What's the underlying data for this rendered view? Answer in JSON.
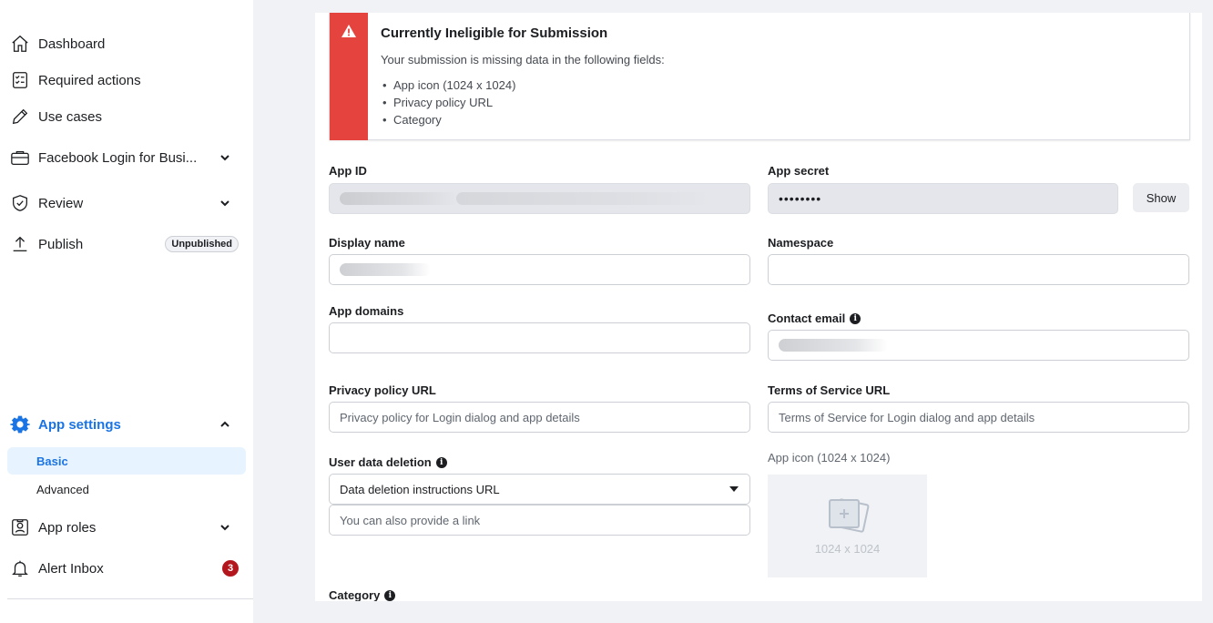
{
  "sidebar": {
    "items": [
      {
        "label": "Dashboard",
        "icon": "home-icon"
      },
      {
        "label": "Required actions",
        "icon": "checklist-icon"
      },
      {
        "label": "Use cases",
        "icon": "pencil-icon"
      },
      {
        "label": "Facebook Login for Busi...",
        "icon": "briefcase-icon"
      },
      {
        "label": "Review",
        "icon": "shield-check-icon"
      },
      {
        "label": "Publish",
        "icon": "upload-icon",
        "badge": "Unpublished"
      },
      {
        "label": "App settings",
        "icon": "gear-icon"
      },
      {
        "label": "App roles",
        "icon": "id-badge-icon"
      },
      {
        "label": "Alert Inbox",
        "icon": "bell-icon",
        "count": "3"
      }
    ],
    "app_settings_sub": [
      {
        "label": "Basic"
      },
      {
        "label": "Advanced"
      }
    ]
  },
  "alert": {
    "title": "Currently Ineligible for Submission",
    "description": "Your submission is missing data in the following fields:",
    "missing": [
      "App icon (1024 x 1024)",
      "Privacy policy URL",
      "Category"
    ],
    "color": "#e5433d"
  },
  "form": {
    "app_id": {
      "label": "App ID"
    },
    "app_secret": {
      "label": "App secret",
      "value": "••••••••",
      "show_label": "Show"
    },
    "display_name": {
      "label": "Display name"
    },
    "namespace": {
      "label": "Namespace"
    },
    "app_domains": {
      "label": "App domains"
    },
    "contact_email": {
      "label": "Contact email"
    },
    "privacy_policy_url": {
      "label": "Privacy policy URL",
      "placeholder": "Privacy policy for Login dialog and app details"
    },
    "terms_url": {
      "label": "Terms of Service URL",
      "placeholder": "Terms of Service for Login dialog and app details"
    },
    "user_data_deletion": {
      "label": "User data deletion",
      "selected": "Data deletion instructions URL",
      "placeholder": "You can also provide a link"
    },
    "app_icon": {
      "label": "App icon (1024 x 1024)",
      "dimensions": "1024 x 1024"
    },
    "category": {
      "label": "Category"
    }
  },
  "colors": {
    "accent": "#1b74e4",
    "alert_badge": "#b3161c"
  }
}
